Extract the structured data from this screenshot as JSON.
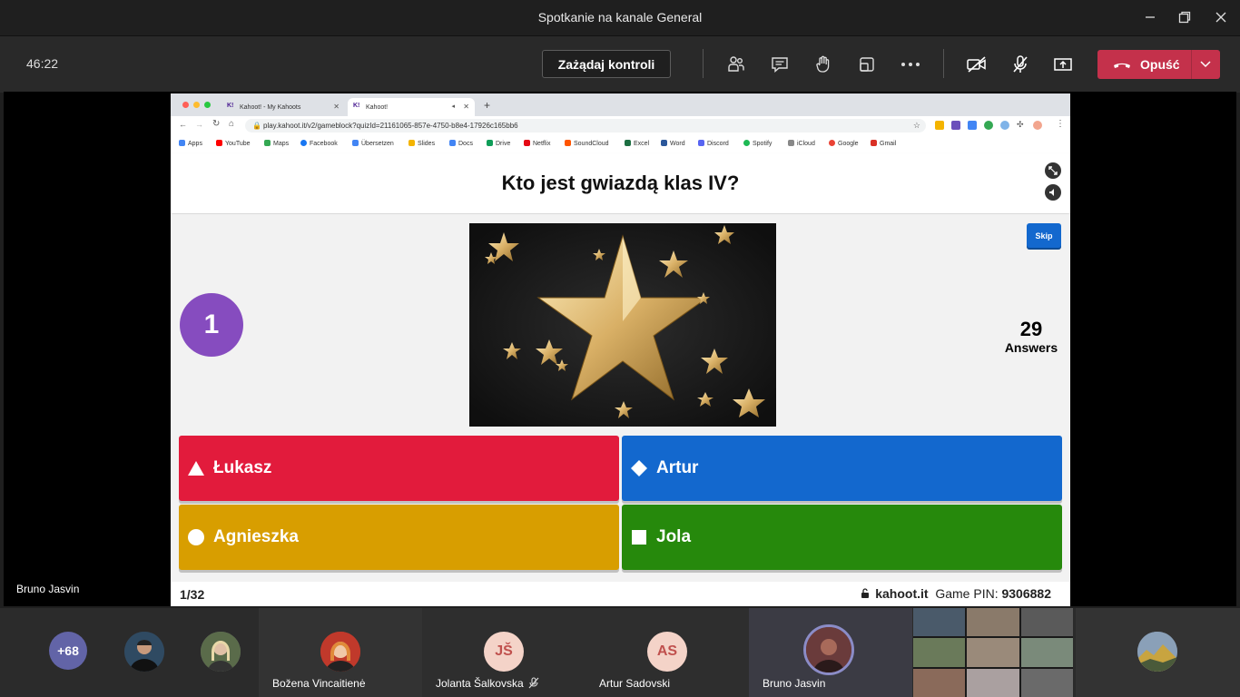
{
  "window": {
    "title": "Spotkanie na kanale General"
  },
  "toolbar": {
    "timer": "46:22",
    "request_control": "Zażądaj kontroli",
    "leave_label": "Opuść"
  },
  "browser": {
    "tabs": [
      {
        "label": "Kahoot! - My Kahoots"
      },
      {
        "label": "Kahoot!"
      }
    ],
    "url": "play.kahoot.it/v2/gameblock?quizId=21161065-857e-4750-b8e4-17926c165bb6",
    "bookmarks": [
      "Apps",
      "YouTube",
      "Maps",
      "Facebook",
      "Übersetzen",
      "Slides",
      "Docs",
      "Drive",
      "Netflix",
      "SoundCloud",
      "Excel",
      "Word",
      "Discord",
      "Spotify",
      "iCloud",
      "Google",
      "Gmail"
    ]
  },
  "kahoot": {
    "question": "Kto jest gwiazdą klas IV?",
    "timer": "1",
    "skip": "Skip",
    "answers_count": "29",
    "answers_label": "Answers",
    "options": [
      {
        "label": "Łukasz",
        "color": "#e21b3c",
        "shape": "triangle-icon"
      },
      {
        "label": "Artur",
        "color": "#1368ce",
        "shape": "diamond-icon"
      },
      {
        "label": "Agnieszka",
        "color": "#d89e00",
        "shape": "circle-icon"
      },
      {
        "label": "Jola",
        "color": "#26890c",
        "shape": "square-icon"
      }
    ],
    "progress": "1/32",
    "site": "kahoot.it",
    "pin_label": "Game PIN:",
    "pin": "9306882"
  },
  "presenter": {
    "name": "Bruno Jasvin"
  },
  "participants": {
    "overflow": "+68",
    "people": [
      {
        "name": "Božena Vincaitienė"
      },
      {
        "name": "Jolanta Šalkovska",
        "initials": "JŠ"
      },
      {
        "name": "Artur Sadovski",
        "initials": "AS"
      },
      {
        "name": "Bruno Jasvin"
      }
    ]
  }
}
